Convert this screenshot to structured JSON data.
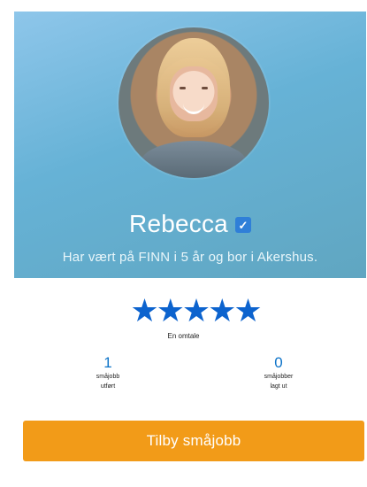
{
  "profile": {
    "name": "Rebecca",
    "bio": "Har vært på FINN i 5 år og bor i Akershus.",
    "verified_icon": "verified-check-icon"
  },
  "rating": {
    "stars": "★★★★★",
    "value": 5,
    "max": 5,
    "label": "En omtale"
  },
  "stats": {
    "jobs_done": {
      "value": "1",
      "label": "småjobb\nutført"
    },
    "jobs_posted": {
      "value": "0",
      "label": "småjobber\nlagt ut"
    }
  },
  "actions": {
    "offer_job": "Tilby småjobb"
  },
  "colors": {
    "hero_start": "#8ec6ea",
    "hero_end": "#60a6c1",
    "accent_blue": "#0c63ce",
    "stat_blue": "#0d73c8",
    "button_orange": "#f29b18",
    "verified_blue": "#2f7fd8"
  }
}
